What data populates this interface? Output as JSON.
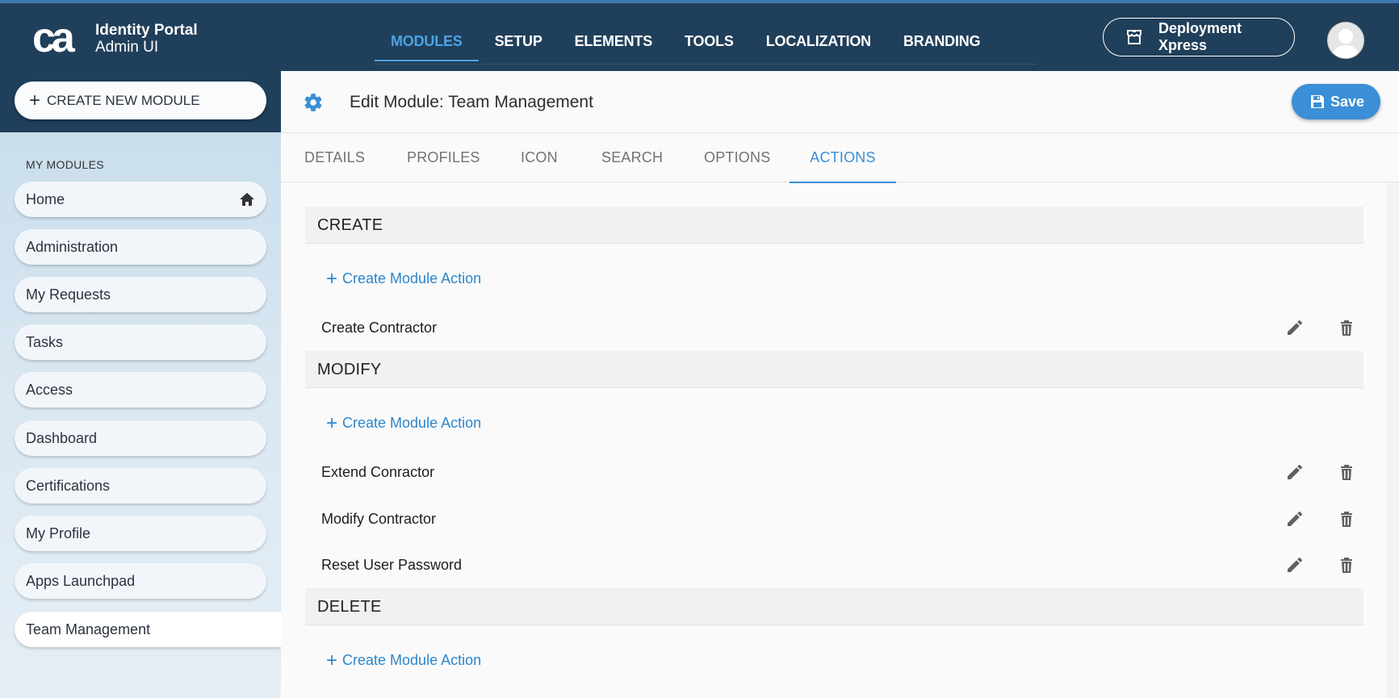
{
  "app": {
    "logo_text": "ca",
    "title_line1": "Identity Portal",
    "title_line2": "Admin UI"
  },
  "nav": {
    "items": [
      "MODULES",
      "SETUP",
      "ELEMENTS",
      "TOOLS",
      "LOCALIZATION",
      "BRANDING"
    ],
    "active": "MODULES",
    "deploy_label": "Deployment Xpress"
  },
  "sidebar": {
    "create_label": "CREATE NEW MODULE",
    "section_label": "MY MODULES",
    "items": [
      {
        "label": "Home"
      },
      {
        "label": "Administration"
      },
      {
        "label": "My Requests"
      },
      {
        "label": "Tasks"
      },
      {
        "label": "Access"
      },
      {
        "label": "Dashboard"
      },
      {
        "label": "Certifications"
      },
      {
        "label": "My Profile"
      },
      {
        "label": "Apps Launchpad"
      },
      {
        "label": "Team Management"
      }
    ],
    "active": "Team Management"
  },
  "main": {
    "title": "Edit Module: Team Management",
    "save_label": "Save",
    "tabs": [
      "DETAILS",
      "PROFILES",
      "ICON",
      "SEARCH",
      "OPTIONS",
      "ACTIONS"
    ],
    "active_tab": "ACTIONS",
    "create_action_label": "Create Module Action",
    "sections": [
      {
        "title": "CREATE",
        "actions": [
          "Create Contractor"
        ]
      },
      {
        "title": "MODIFY",
        "actions": [
          "Extend Conractor",
          "Modify Contractor",
          "Reset User Password"
        ]
      },
      {
        "title": "DELETE",
        "actions": []
      }
    ]
  },
  "colors": {
    "topbar": "#203f5a",
    "accent": "#3a8fd6",
    "nav_active": "#4aa3e6"
  },
  "icons": {
    "gear": "gear-icon",
    "save": "floppy-icon",
    "home": "home-icon",
    "edit": "pencil-icon",
    "delete": "trash-icon",
    "deploy": "storefront-icon"
  }
}
